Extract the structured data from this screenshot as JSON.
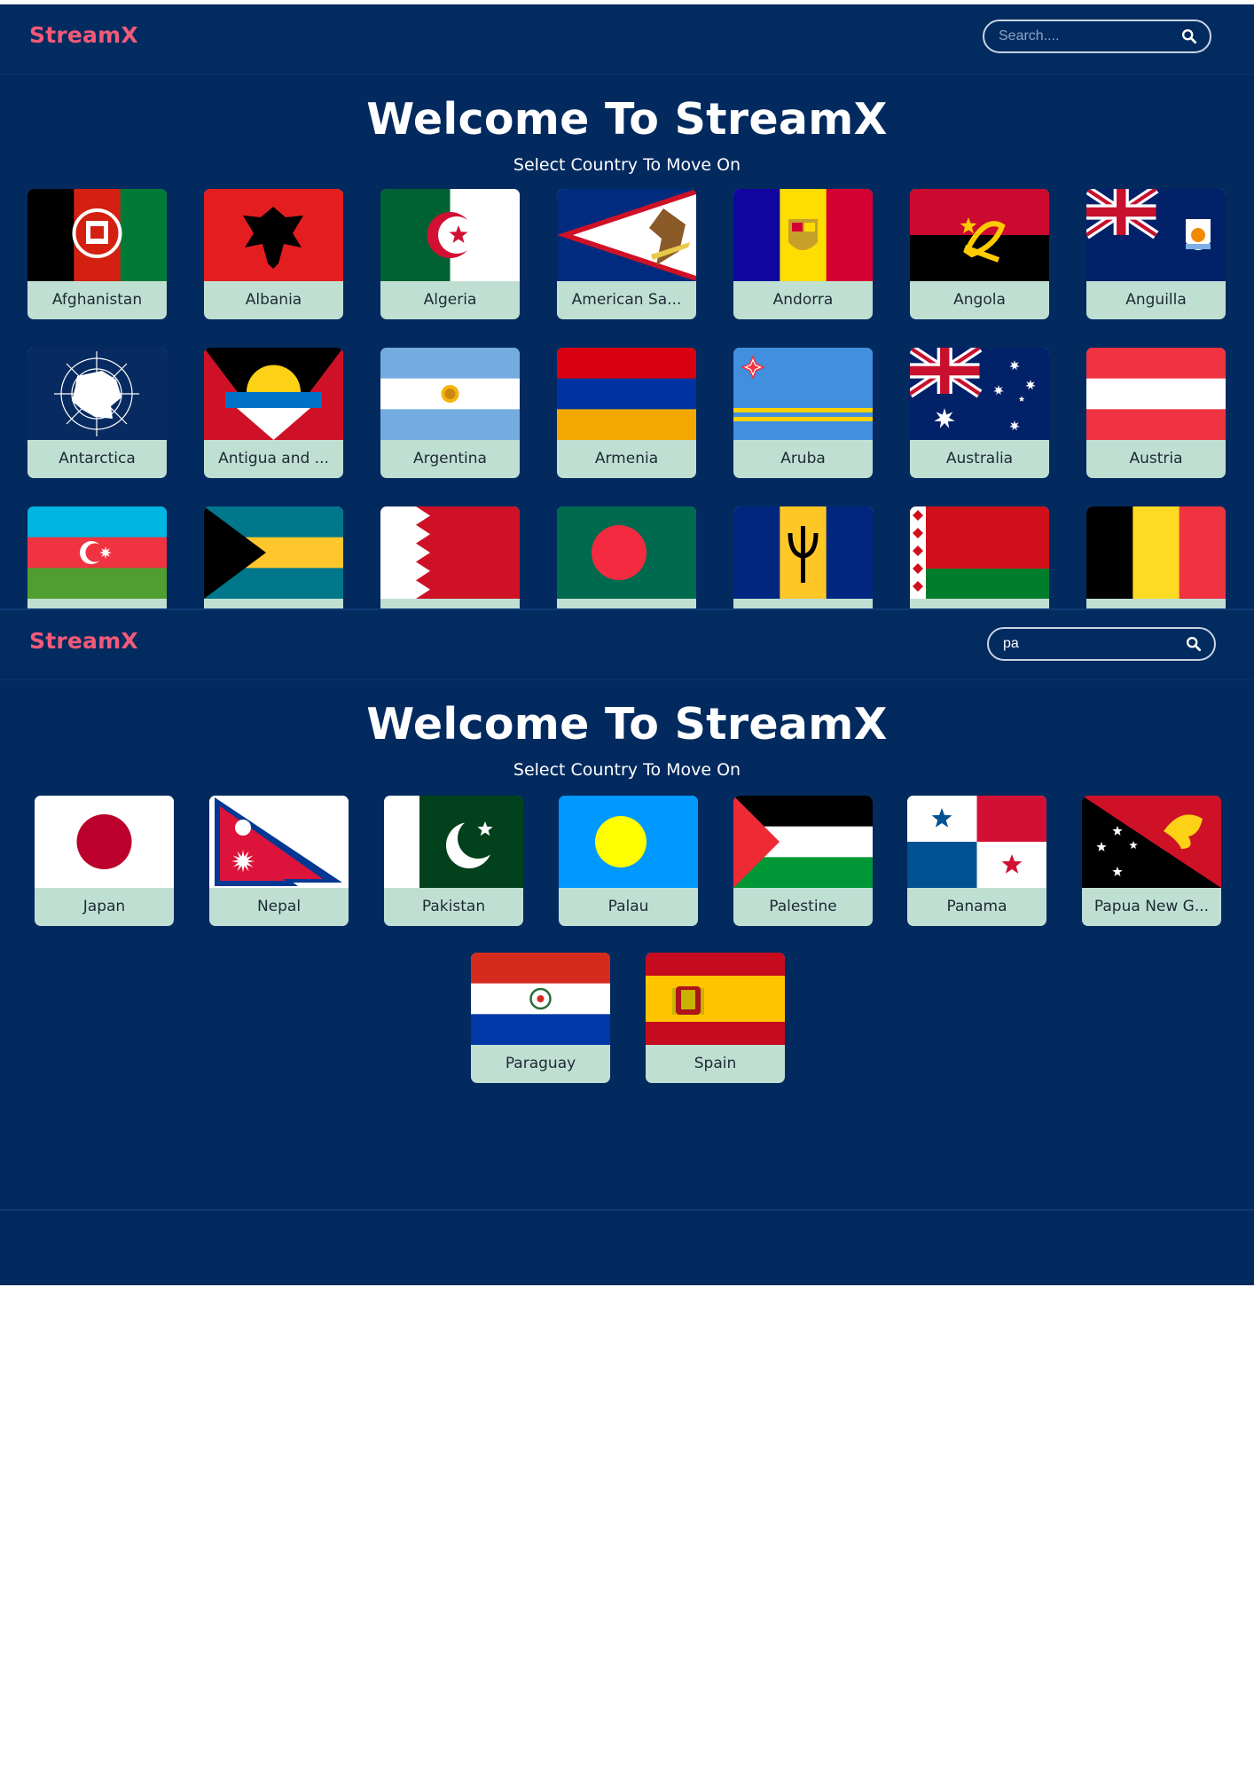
{
  "colors": {
    "background": "#022a5f",
    "brand": "#f25a79",
    "card_label_bg": "#c0dfd3"
  },
  "screens": [
    {
      "brand": "StreamX",
      "search": {
        "value": "",
        "placeholder": "Search....",
        "icon": "magnifier"
      },
      "title": "Welcome To StreamX",
      "subtitle": "Select Country To Move On",
      "countries": [
        {
          "name": "Afghanistan",
          "flag": "af"
        },
        {
          "name": "Albania",
          "flag": "al"
        },
        {
          "name": "Algeria",
          "flag": "dz"
        },
        {
          "name": "American Sa...",
          "flag": "as"
        },
        {
          "name": "Andorra",
          "flag": "ad"
        },
        {
          "name": "Angola",
          "flag": "ao"
        },
        {
          "name": "Anguilla",
          "flag": "ai"
        },
        {
          "name": "Antarctica",
          "flag": "aq"
        },
        {
          "name": "Antigua and ...",
          "flag": "ag"
        },
        {
          "name": "Argentina",
          "flag": "ar"
        },
        {
          "name": "Armenia",
          "flag": "am"
        },
        {
          "name": "Aruba",
          "flag": "aw"
        },
        {
          "name": "Australia",
          "flag": "au"
        },
        {
          "name": "Austria",
          "flag": "at"
        },
        {
          "name": "",
          "flag": "az"
        },
        {
          "name": "",
          "flag": "bs"
        },
        {
          "name": "",
          "flag": "bh"
        },
        {
          "name": "",
          "flag": "bd"
        },
        {
          "name": "",
          "flag": "bb"
        },
        {
          "name": "",
          "flag": "by"
        },
        {
          "name": "",
          "flag": "be"
        }
      ]
    },
    {
      "brand": "StreamX",
      "search": {
        "value": "pa",
        "placeholder": "Search....",
        "icon": "magnifier"
      },
      "title": "Welcome To StreamX",
      "subtitle": "Select Country To Move On",
      "countries": [
        {
          "name": "Japan",
          "flag": "jp"
        },
        {
          "name": "Nepal",
          "flag": "np"
        },
        {
          "name": "Pakistan",
          "flag": "pk"
        },
        {
          "name": "Palau",
          "flag": "pw"
        },
        {
          "name": "Palestine",
          "flag": "ps"
        },
        {
          "name": "Panama",
          "flag": "pa"
        },
        {
          "name": "Papua New G...",
          "flag": "pg"
        },
        {
          "name": "Paraguay",
          "flag": "py"
        },
        {
          "name": "Spain",
          "flag": "es"
        }
      ]
    }
  ]
}
